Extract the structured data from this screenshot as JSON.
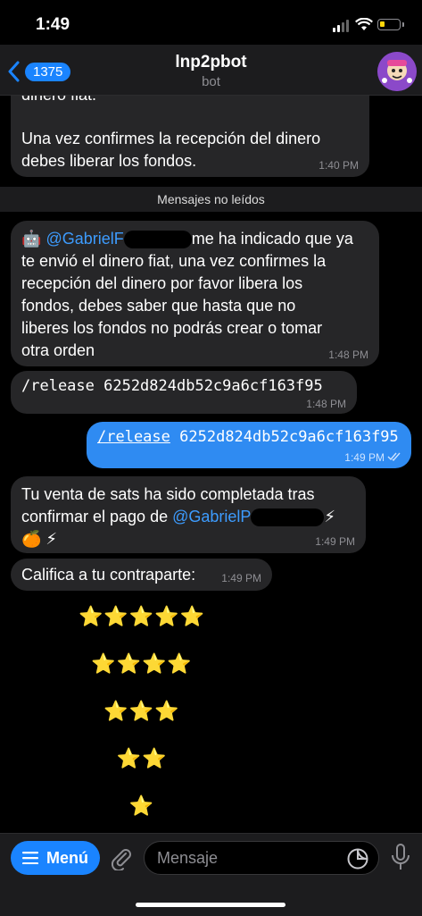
{
  "status_bar": {
    "time": "1:49"
  },
  "header": {
    "back_count": "1375",
    "title": "lnp2pbot",
    "subtitle": "bot"
  },
  "messages": {
    "m1_line1": "dinero fiat.",
    "m1_line2": "Una vez confirmes la recepción del dinero",
    "m1_line3": "debes liberar los fondos.",
    "m1_time": "1:40 PM",
    "unread_label": "Mensajes no leídos",
    "m2_emoji": "🤖",
    "m2_mention": "@GabrielF",
    "m2_line1_rest": "me ha indicado que ya",
    "m2_line2": "te envió el dinero fiat, una vez confirmes la",
    "m2_line3": "recepción del dinero por favor libera los",
    "m2_line4": "fondos, debes saber que hasta que no",
    "m2_line5": "liberes los fondos no podrás crear o tomar",
    "m2_line6": "otra orden",
    "m2_time": "1:48 PM",
    "m3_text": "/release 6252d824db52c9a6cf163f95",
    "m3_time": "1:48 PM",
    "m4_command": "/release",
    "m4_arg": "6252d824db52c9a6cf163f95",
    "m4_time": "1:49 PM",
    "m5_line1": "Tu venta de sats ha sido completada tras",
    "m5_line2_text": "confirmar el pago de",
    "m5_mention": "@GabrielP",
    "m5_bolt": "⚡",
    "m5_line3": "🍊 ⚡",
    "m5_time": "1:49 PM",
    "m6_text": "Califica a tu contraparte:",
    "m6_time": "1:49 PM"
  },
  "rating_buttons": [
    "⭐⭐⭐⭐⭐",
    "⭐⭐⭐⭐",
    "⭐⭐⭐",
    "⭐⭐",
    "⭐"
  ],
  "bottom_bar": {
    "menu_label": "Menú",
    "input_placeholder": "Mensaje"
  },
  "colors": {
    "accent": "#1a84ff",
    "outgoing_bubble": "#2f8bf2",
    "incoming_bubble": "#262628",
    "link": "#3d9cff"
  },
  "icons": [
    "back-chevron-icon",
    "signal-icon",
    "wifi-icon",
    "battery-icon",
    "menu-icon",
    "attachment-icon",
    "sticker-icon",
    "microphone-icon",
    "read-checkmarks-icon"
  ]
}
